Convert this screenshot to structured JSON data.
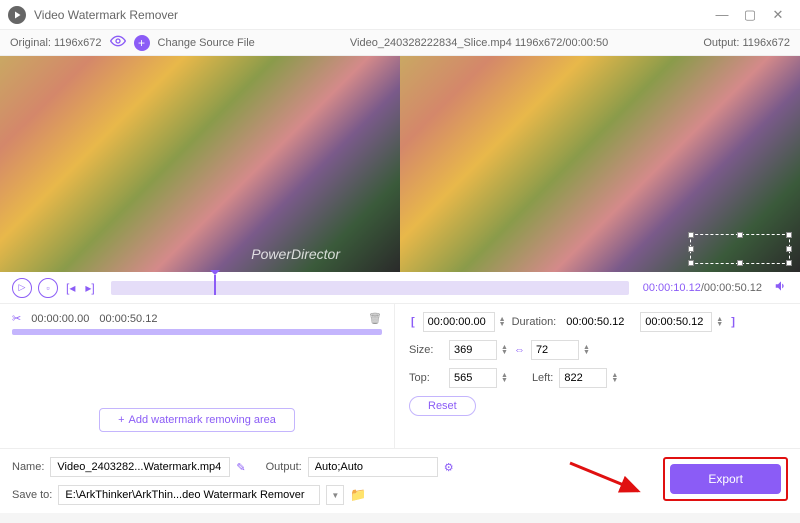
{
  "titlebar": {
    "title": "Video Watermark Remover"
  },
  "topbar": {
    "original": "Original:  1196x672",
    "change_src": "Change Source File",
    "file_info": "Video_240328222834_Slice.mp4     1196x672/00:00:50",
    "output": "Output:  1196x672"
  },
  "preview": {
    "watermark_text": "PowerDirector"
  },
  "playback": {
    "current": "00:00:10.12",
    "total": "/00:00:50.12"
  },
  "segment": {
    "start": "00:00:00.00",
    "end": "00:00:50.12"
  },
  "range": {
    "start": "00:00:00.00",
    "duration_label": "Duration:",
    "duration": "00:00:50.12",
    "end": "00:00:50.12"
  },
  "size": {
    "label": "Size:",
    "w": "369",
    "h": "72"
  },
  "pos": {
    "top_label": "Top:",
    "top": "565",
    "left_label": "Left:",
    "left": "822"
  },
  "buttons": {
    "add_area": "Add watermark removing area",
    "reset": "Reset",
    "export": "Export"
  },
  "bottom": {
    "name_label": "Name:",
    "name": "Video_2403282...Watermark.mp4",
    "output_label": "Output:",
    "output": "Auto;Auto",
    "save_label": "Save to:",
    "save_path": "E:\\ArkThinker\\ArkThin...deo Watermark Remover"
  }
}
